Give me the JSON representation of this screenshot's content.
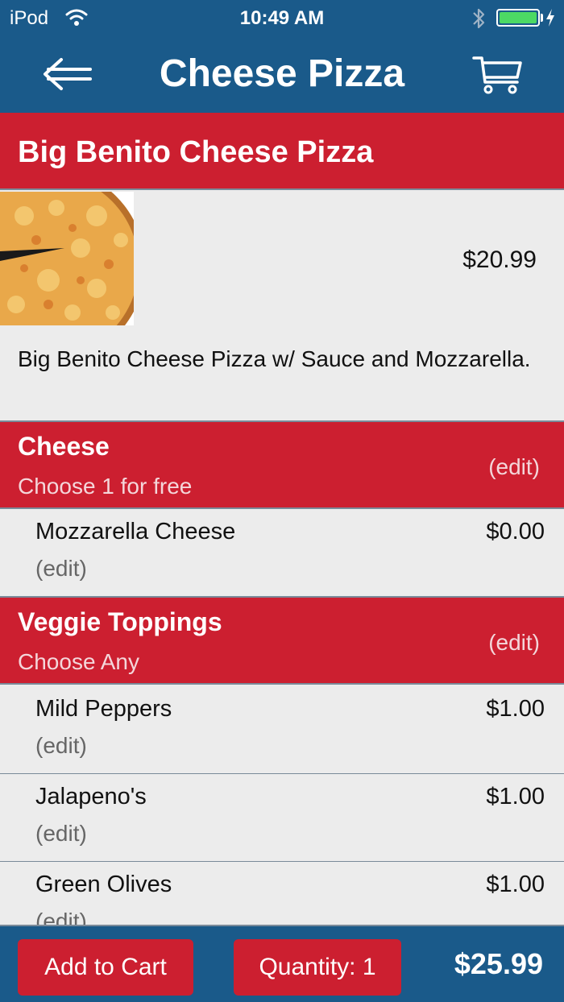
{
  "status_bar": {
    "carrier": "iPod",
    "time": "10:49 AM",
    "battery_color": "#4cd964"
  },
  "nav": {
    "title": "Cheese Pizza",
    "back_icon": "back-arrow-icon",
    "cart_icon": "cart-icon"
  },
  "product": {
    "name": "Big Benito Cheese Pizza",
    "price": "$20.99",
    "description": "Big Benito Cheese Pizza w/ Sauce and Mozzarella."
  },
  "sections": [
    {
      "title": "Cheese",
      "subtitle": "Choose 1 for free",
      "edit_label": "(edit)",
      "items": [
        {
          "name": "Mozzarella Cheese",
          "price": "$0.00",
          "edit_label": "(edit)"
        }
      ]
    },
    {
      "title": "Veggie Toppings",
      "subtitle": "Choose Any",
      "edit_label": "(edit)",
      "items": [
        {
          "name": "Mild Peppers",
          "price": "$1.00",
          "edit_label": "(edit)"
        },
        {
          "name": "Jalapeno's",
          "price": "$1.00",
          "edit_label": "(edit)"
        },
        {
          "name": "Green Olives",
          "price": "$1.00",
          "edit_label": "(edit)"
        }
      ]
    }
  ],
  "bottom_bar": {
    "add_to_cart_label": "Add to Cart",
    "quantity_label": "Quantity: 1",
    "total": "$25.99"
  },
  "colors": {
    "header_blue": "#1a5a8a",
    "accent_red": "#cc1f30",
    "background": "#ececec"
  }
}
